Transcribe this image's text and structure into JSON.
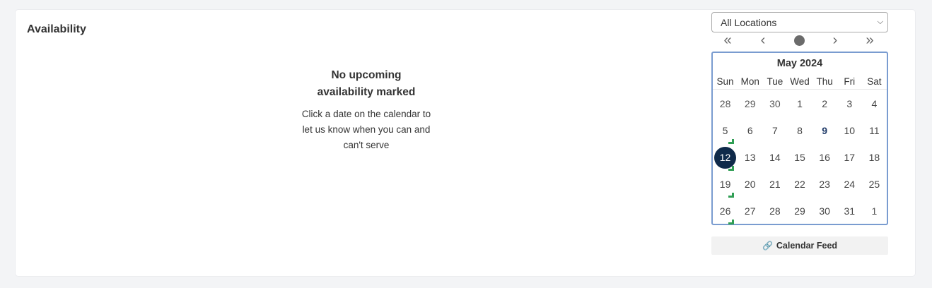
{
  "section": {
    "title": "Availability",
    "empty_title_line1": "No upcoming",
    "empty_title_line2": "availability marked",
    "empty_desc_line1": "Click a date on the calendar to",
    "empty_desc_line2": "let us know when you can and",
    "empty_desc_line3": "can't serve"
  },
  "location_select": {
    "selected": "All Locations"
  },
  "calendar": {
    "month": "May 2024",
    "nav_icons": [
      "double-chevron-left-icon",
      "chevron-left-icon",
      "today-dot-icon",
      "chevron-right-icon",
      "double-chevron-right-icon"
    ],
    "weekdays": [
      "Sun",
      "Mon",
      "Tue",
      "Wed",
      "Thu",
      "Fri",
      "Sat"
    ],
    "weeks": [
      [
        "28",
        "29",
        "30",
        "1",
        "2",
        "3",
        "4"
      ],
      [
        "5",
        "6",
        "7",
        "8",
        "9",
        "10",
        "11"
      ],
      [
        "12",
        "13",
        "14",
        "15",
        "16",
        "17",
        "18"
      ],
      [
        "19",
        "20",
        "21",
        "22",
        "23",
        "24",
        "25"
      ],
      [
        "26",
        "27",
        "28",
        "29",
        "30",
        "31",
        "1"
      ]
    ],
    "selected_date": "12",
    "highlighted_date": "9",
    "marked_dates": [
      "5",
      "12",
      "19",
      "26"
    ],
    "colors": {
      "border": "#7a9cd0",
      "selected_bg": "#0f2a4a",
      "mark": "#2f9e54"
    }
  },
  "calendar_feed": {
    "label": "Calendar Feed",
    "icon": "link-icon"
  }
}
